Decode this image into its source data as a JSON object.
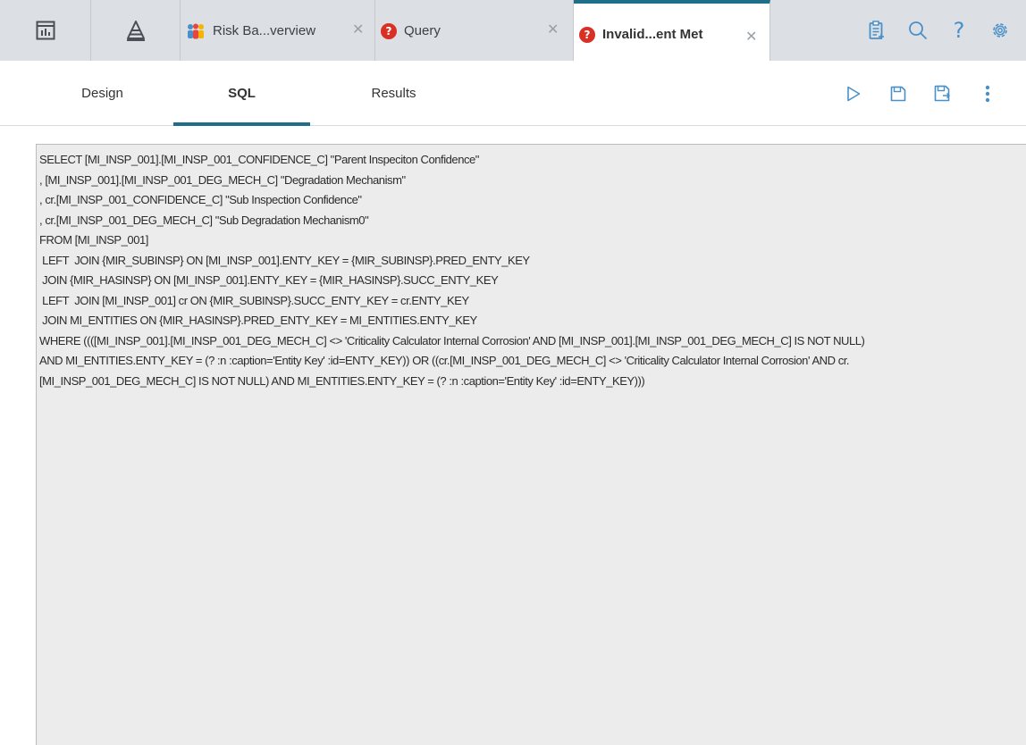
{
  "tabs": [
    {
      "title": "Risk Ba...verview",
      "icon": "risk-people-icon"
    },
    {
      "title": "Query",
      "icon": "error-icon"
    },
    {
      "title": "Invalid...ent Met",
      "icon": "error-icon",
      "active": true
    }
  ],
  "error_glyph": "?",
  "close_glyph": "✕",
  "toolbar_icons": [
    "dashboard-icon",
    "pyramid-icon",
    "clipboard-icon",
    "search-icon",
    "help-icon",
    "settings-icon"
  ],
  "help_glyph": "?",
  "subtabs": {
    "design": "Design",
    "sql": "SQL",
    "results": "Results"
  },
  "actions": [
    "run-icon",
    "save-icon",
    "save-as-icon",
    "more-icon"
  ],
  "sql": {
    "lines": [
      "SELECT [MI_INSP_001].[MI_INSP_001_CONFIDENCE_C] \"Parent Inspeciton Confidence\"",
      ", [MI_INSP_001].[MI_INSP_001_DEG_MECH_C] \"Degradation Mechanism\"",
      ", cr.[MI_INSP_001_CONFIDENCE_C] \"Sub Inspection Confidence\"",
      ", cr.[MI_INSP_001_DEG_MECH_C] \"Sub Degradation Mechanism0\"",
      "FROM [MI_INSP_001]",
      " LEFT  JOIN {MIR_SUBINSP} ON [MI_INSP_001].ENTY_KEY = {MIR_SUBINSP}.PRED_ENTY_KEY",
      " JOIN {MIR_HASINSP} ON [MI_INSP_001].ENTY_KEY = {MIR_HASINSP}.SUCC_ENTY_KEY",
      " LEFT  JOIN [MI_INSP_001] cr ON {MIR_SUBINSP}.SUCC_ENTY_KEY = cr.ENTY_KEY",
      " JOIN MI_ENTITIES ON {MIR_HASINSP}.PRED_ENTY_KEY = MI_ENTITIES.ENTY_KEY",
      "WHERE ((([MI_INSP_001].[MI_INSP_001_DEG_MECH_C] <> 'Criticality Calculator Internal Corrosion' AND [MI_INSP_001].[MI_INSP_001_DEG_MECH_C] IS NOT NULL)",
      "AND MI_ENTITIES.ENTY_KEY = (? :n :caption='Entity Key' :id=ENTY_KEY)) OR ((cr.[MI_INSP_001_DEG_MECH_C] <> 'Criticality Calculator Internal Corrosion' AND cr.",
      "[MI_INSP_001_DEG_MECH_C] IS NOT NULL) AND MI_ENTITIES.ENTY_KEY = (? :n :caption='Entity Key' :id=ENTY_KEY)))"
    ]
  }
}
